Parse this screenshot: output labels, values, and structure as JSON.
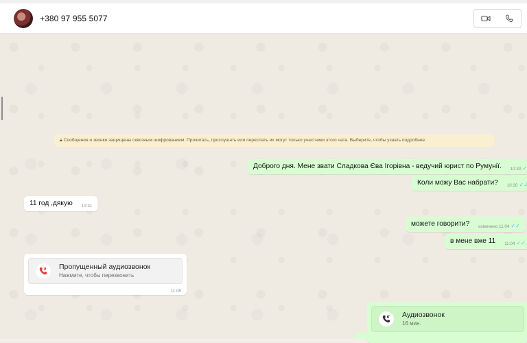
{
  "header": {
    "contact_name": "+380 97 955 5077",
    "video_icon": "video-camera-icon",
    "call_icon": "phone-icon"
  },
  "chat": {
    "encryption_notice": "Сообщения и звонки защищены сквозным шифрованием. Прочитать, прослушать или переслать их могут только участники этого чата. Выберите, чтобы узнать подробнее.",
    "messages": [
      {
        "direction": "out",
        "text": "Доброго дня. Мене звати Сладкова Єва Ігорівна - ведучий юрист по Румунії.",
        "time": "10:30",
        "status": "read"
      },
      {
        "direction": "out",
        "text": "Коли можу Вас набрати?",
        "time": "10:30",
        "status": "read"
      },
      {
        "direction": "in",
        "text": "11 год ,дякую",
        "time": "10:31"
      },
      {
        "direction": "out",
        "text": "можете говорити?",
        "time": "изменено 11:04",
        "status": "read"
      },
      {
        "direction": "out",
        "text": "в мене вже 11",
        "time": "11:04",
        "status": "read"
      }
    ],
    "missed_call": {
      "title": "Пропущенный аудиозвонок",
      "subtitle": "Нажмите, чтобы перезвонить",
      "time": "11:05",
      "icon": "missed-call-icon"
    },
    "audio_call": {
      "title": "Аудиозвонок",
      "subtitle": "16 мин.",
      "icon": "incoming-call-icon"
    }
  },
  "colors": {
    "outgoing_bubble": "#d9fdd3",
    "incoming_bubble": "#ffffff",
    "notice_bg": "#fbefd2",
    "read_tick": "#53bdeb",
    "missed_red": "#e53935"
  }
}
